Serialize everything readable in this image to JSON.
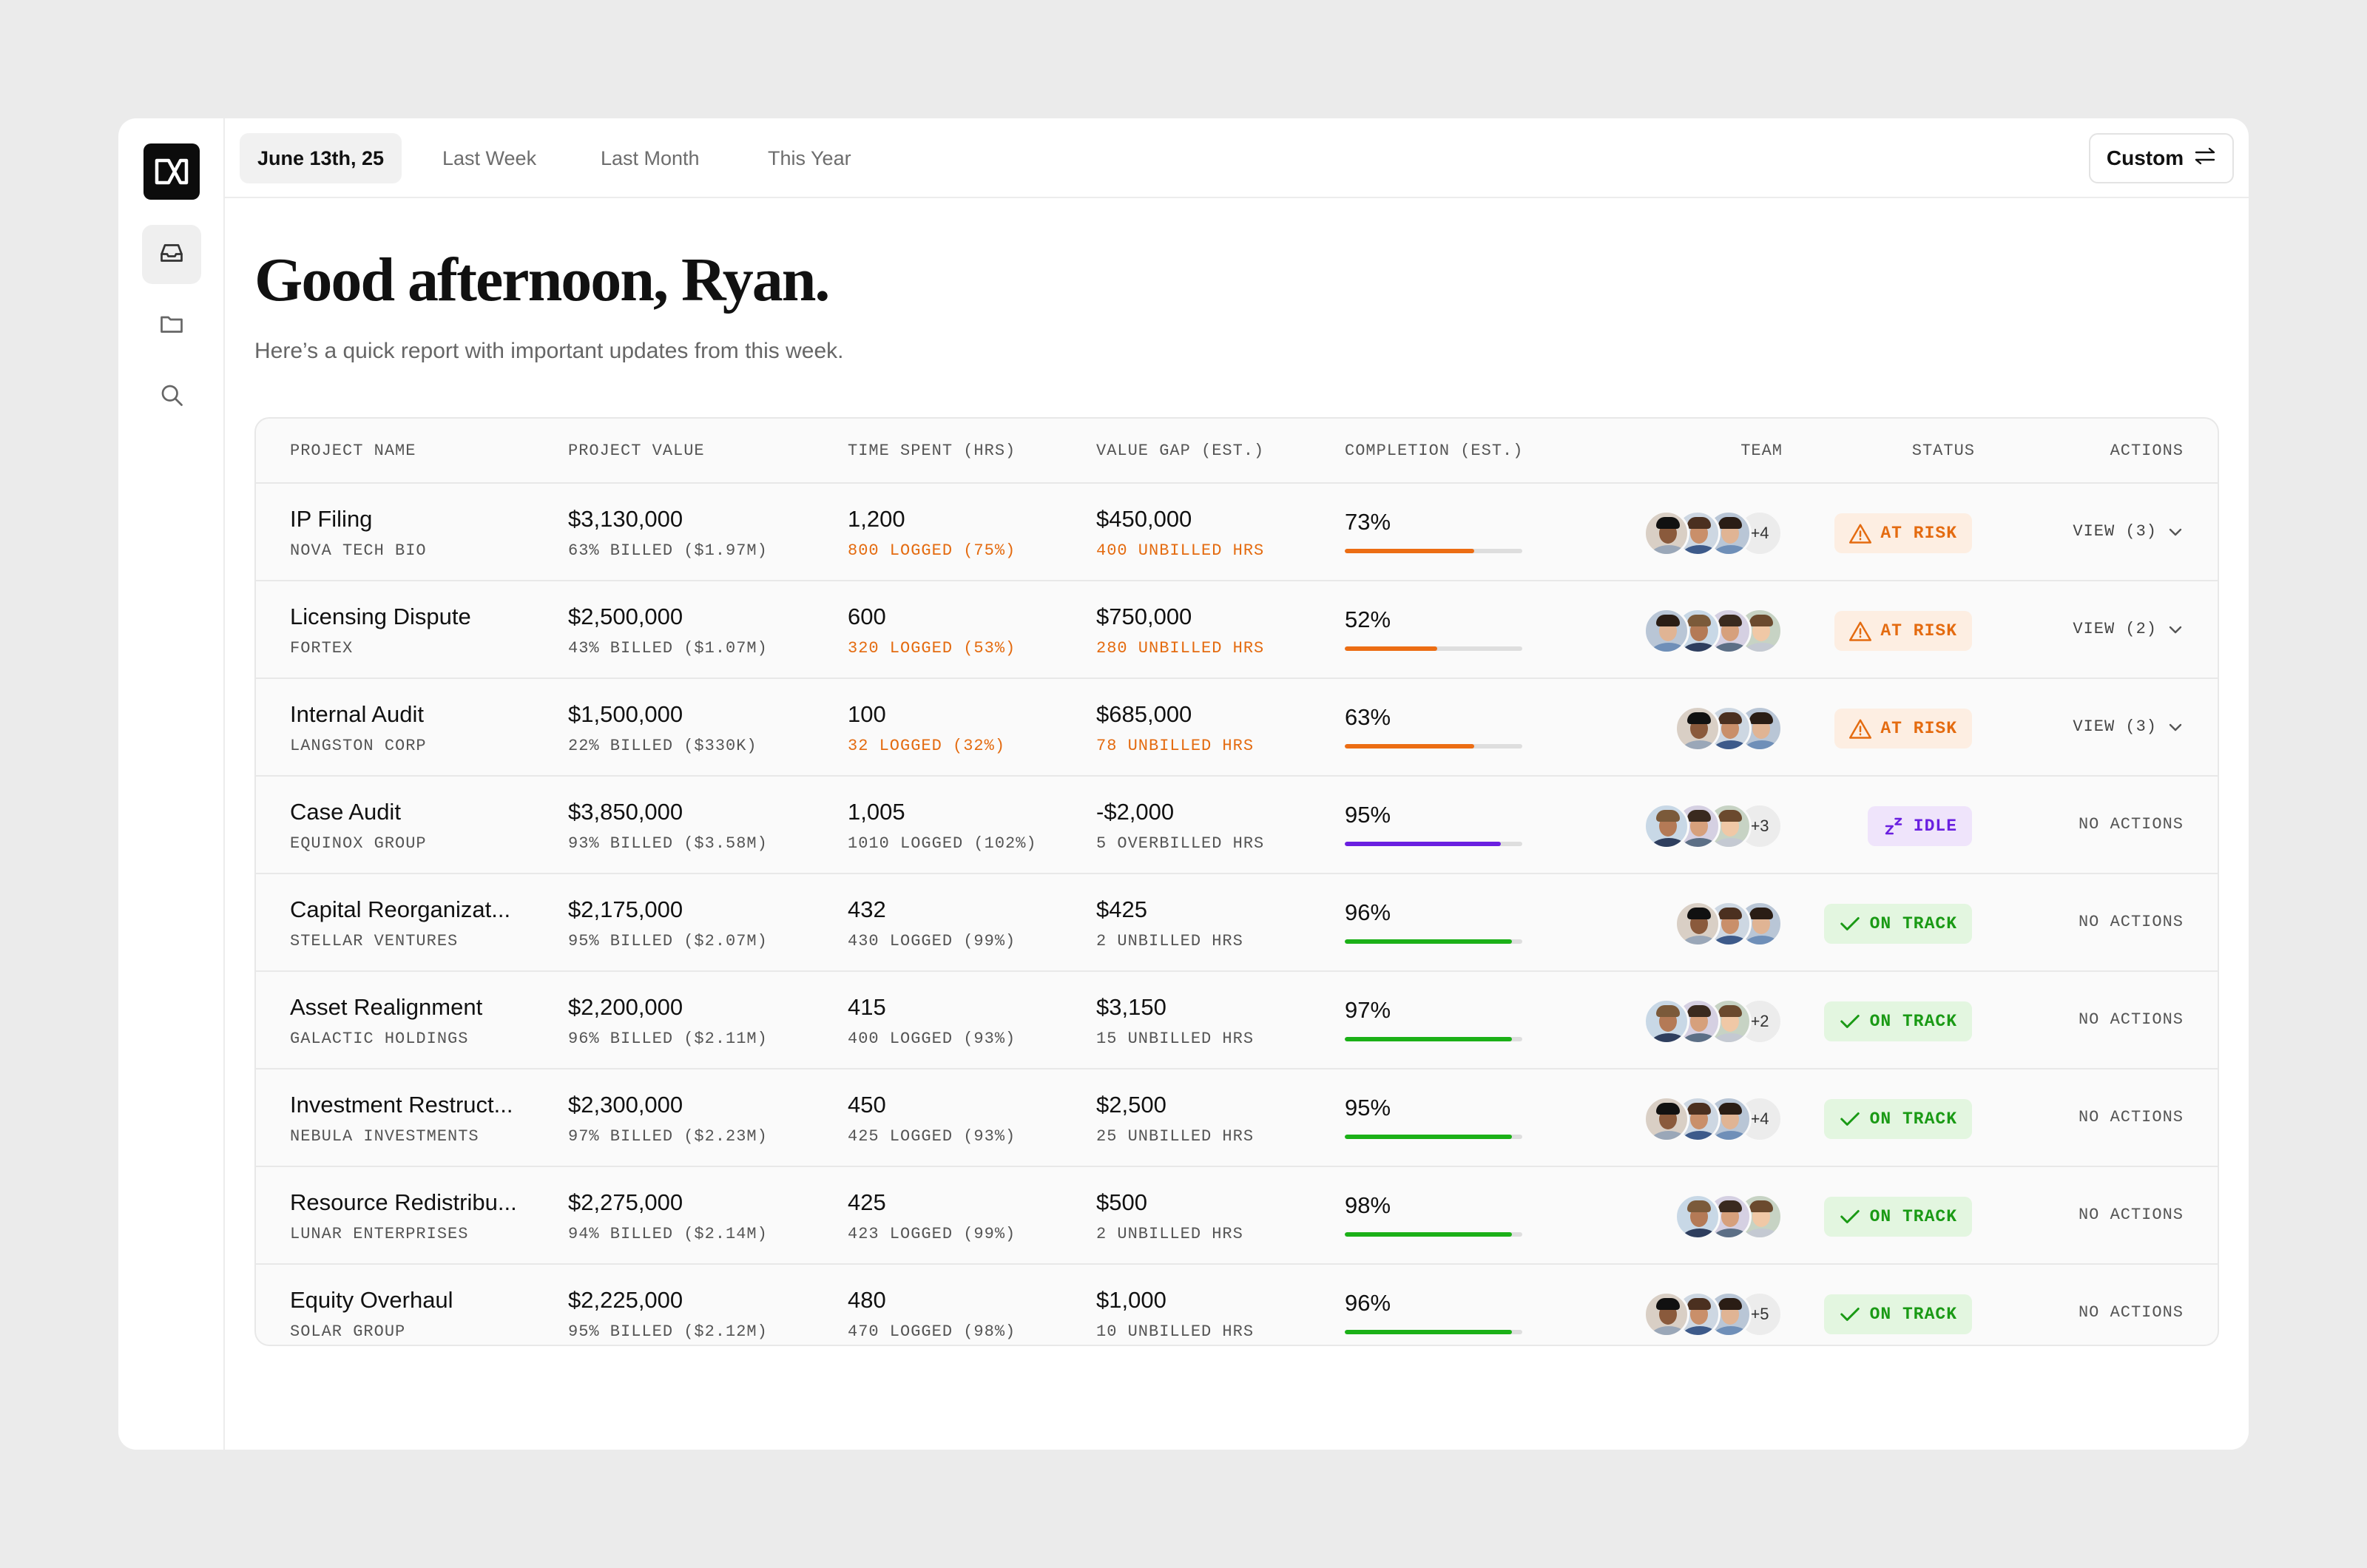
{
  "tabs": [
    {
      "label": "June 13th, 25",
      "active": true
    },
    {
      "label": "Last Week",
      "active": false
    },
    {
      "label": "Last Month",
      "active": false
    },
    {
      "label": "This Year",
      "active": false
    }
  ],
  "custom_button": "Custom",
  "sidebar": {
    "logo": "logo-icon",
    "items": [
      {
        "icon": "inbox-icon",
        "active": true
      },
      {
        "icon": "folder-icon",
        "active": false
      },
      {
        "icon": "search-icon",
        "active": false
      }
    ]
  },
  "greeting": "Good afternoon, Ryan.",
  "subtitle": "Here’s a quick report with important updates from this week.",
  "table": {
    "headers": {
      "project_name": "PROJECT NAME",
      "project_value": "PROJECT VALUE",
      "time_spent": "TIME SPENT (HRS)",
      "value_gap": "VALUE GAP (EST.)",
      "completion": "COMPLETION (EST.)",
      "team": "TEAM",
      "status": "STATUS",
      "actions": "ACTIONS"
    },
    "rows": [
      {
        "name": "IP Filing",
        "client": "NOVA TECH BIO",
        "value": "$3,130,000",
        "billed": "63% BILLED ($1.97M)",
        "time": "1,200",
        "logged": "800 LOGGED (75%)",
        "logged_warn": true,
        "gap": "$450,000",
        "gap_sub": "400 UNBILLED HRS",
        "gap_warn": true,
        "completion": "73%",
        "completion_value": 0.73,
        "bar_color": "#ec6d13",
        "avatars": 3,
        "more": "+4",
        "status": "AT RISK",
        "status_type": "risk",
        "action": "VIEW (3)",
        "has_chevron": true
      },
      {
        "name": "Licensing Dispute",
        "client": "FORTEX",
        "value": "$2,500,000",
        "billed": "43% BILLED ($1.07M)",
        "time": "600",
        "logged": "320 LOGGED (53%)",
        "logged_warn": true,
        "gap": "$750,000",
        "gap_sub": "280 UNBILLED HRS",
        "gap_warn": true,
        "completion": "52%",
        "completion_value": 0.52,
        "bar_color": "#ec6d13",
        "avatars": 4,
        "more": "",
        "status": "AT RISK",
        "status_type": "risk",
        "action": "VIEW (2)",
        "has_chevron": true
      },
      {
        "name": "Internal Audit",
        "client": "LANGSTON CORP",
        "value": "$1,500,000",
        "billed": "22% BILLED ($330K)",
        "time": "100",
        "logged": "32 LOGGED (32%)",
        "logged_warn": true,
        "gap": "$685,000",
        "gap_sub": "78 UNBILLED HRS",
        "gap_warn": true,
        "completion": "63%",
        "completion_value": 0.73,
        "bar_color": "#ec6d13",
        "avatars": 3,
        "more": "",
        "status": "AT RISK",
        "status_type": "risk",
        "action": "VIEW (3)",
        "has_chevron": true
      },
      {
        "name": "Case Audit",
        "client": "EQUINOX GROUP",
        "value": "$3,850,000",
        "billed": "93% BILLED ($3.58M)",
        "time": "1,005",
        "logged": "1010 LOGGED (102%)",
        "logged_warn": false,
        "gap": "-$2,000",
        "gap_sub": "5 OVERBILLED HRS",
        "gap_warn": false,
        "completion": "95%",
        "completion_value": 0.88,
        "bar_color": "#6a1fe0",
        "avatars": 3,
        "more": "+3",
        "status": "IDLE",
        "status_type": "idle",
        "action": "NO ACTIONS",
        "has_chevron": false
      },
      {
        "name": "Capital Reorganizat...",
        "client": "STELLAR VENTURES",
        "value": "$2,175,000",
        "billed": "95% BILLED ($2.07M)",
        "time": "432",
        "logged": "430 LOGGED (99%)",
        "logged_warn": false,
        "gap": "$425",
        "gap_sub": "2 UNBILLED HRS",
        "gap_warn": false,
        "completion": "96%",
        "completion_value": 0.94,
        "bar_color": "#1bb017",
        "avatars": 3,
        "more": "",
        "status": "ON TRACK",
        "status_type": "ok",
        "action": "NO ACTIONS",
        "has_chevron": false
      },
      {
        "name": "Asset Realignment",
        "client": "GALACTIC HOLDINGS",
        "value": "$2,200,000",
        "billed": "96% BILLED ($2.11M)",
        "time": "415",
        "logged": "400 LOGGED (93%)",
        "logged_warn": false,
        "gap": "$3,150",
        "gap_sub": "15 UNBILLED HRS",
        "gap_warn": false,
        "completion": "97%",
        "completion_value": 0.94,
        "bar_color": "#1bb017",
        "avatars": 3,
        "more": "+2",
        "status": "ON TRACK",
        "status_type": "ok",
        "action": "NO ACTIONS",
        "has_chevron": false
      },
      {
        "name": "Investment Restruct...",
        "client": "NEBULA INVESTMENTS",
        "value": "$2,300,000",
        "billed": "97% BILLED ($2.23M)",
        "time": "450",
        "logged": "425 LOGGED (93%)",
        "logged_warn": false,
        "gap": "$2,500",
        "gap_sub": "25 UNBILLED HRS",
        "gap_warn": false,
        "completion": "95%",
        "completion_value": 0.94,
        "bar_color": "#1bb017",
        "avatars": 3,
        "more": "+4",
        "status": "ON TRACK",
        "status_type": "ok",
        "action": "NO ACTIONS",
        "has_chevron": false
      },
      {
        "name": "Resource Redistribu...",
        "client": "LUNAR ENTERPRISES",
        "value": "$2,275,000",
        "billed": "94% BILLED ($2.14M)",
        "time": "425",
        "logged": "423 LOGGED (99%)",
        "logged_warn": false,
        "gap": "$500",
        "gap_sub": "2 UNBILLED HRS",
        "gap_warn": false,
        "completion": "98%",
        "completion_value": 0.94,
        "bar_color": "#1bb017",
        "avatars": 3,
        "more": "",
        "status": "ON TRACK",
        "status_type": "ok",
        "action": "NO ACTIONS",
        "has_chevron": false
      },
      {
        "name": "Equity Overhaul",
        "client": "SOLAR GROUP",
        "value": "$2,225,000",
        "billed": "95% BILLED ($2.12M)",
        "time": "480",
        "logged": "470 LOGGED (98%)",
        "logged_warn": false,
        "gap": "$1,000",
        "gap_sub": "10 UNBILLED HRS",
        "gap_warn": false,
        "completion": "96%",
        "completion_value": 0.94,
        "bar_color": "#1bb017",
        "avatars": 3,
        "more": "+5",
        "status": "ON TRACK",
        "status_type": "ok",
        "action": "NO ACTIONS",
        "has_chevron": false
      }
    ]
  },
  "colors": {
    "risk_bg": "#fdeee2",
    "risk_fg": "#e46b10",
    "idle_bg": "#efe4fb",
    "idle_fg": "#6a1fe0",
    "ok_bg": "#e3f6e0",
    "ok_fg": "#1a9a15"
  }
}
